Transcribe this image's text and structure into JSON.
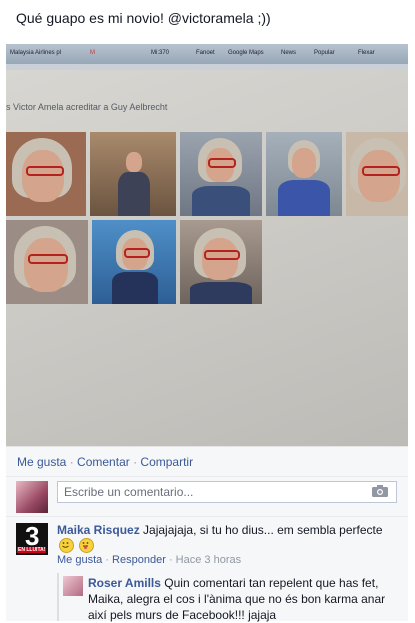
{
  "post": {
    "text": "Qué guapo es mi novio! @victoramela ;))"
  },
  "photo": {
    "browser_bar": {
      "tab_label": "Malaysia Airlines pl",
      "bookmarks": [
        "Fanoet",
        "Google Maps",
        "News",
        "Popular",
        "Flexar"
      ],
      "short_label": "Mi:370"
    },
    "screen_title": "s Victor Amela acreditar a Guy Aelbrecht"
  },
  "actions": {
    "like": "Me gusta",
    "comment": "Comentar",
    "share": "Compartir",
    "separator": "·"
  },
  "composer": {
    "placeholder": "Escribe un comentario...",
    "camera_icon": "camera-icon"
  },
  "comments": [
    {
      "author": "Maika Risquez",
      "text": "Jajajajaja, si tu ho dius... em sembla perfecte",
      "like": "Me gusta",
      "reply": "Responder",
      "time": "Hace 3 horas",
      "logo_text": "3",
      "logo_sub": "EN LLUITA!"
    }
  ],
  "reply": {
    "author": "Roser Amills",
    "text": "Quin comentari tan repelent que has fet, Maika, alegra el cos i l'ànima que no és bon karma anar així pels murs de Facebook!!! jajaja"
  },
  "colors": {
    "link": "#3b5998",
    "background": "#f6f7f8",
    "frame_red": "#b3221e"
  }
}
